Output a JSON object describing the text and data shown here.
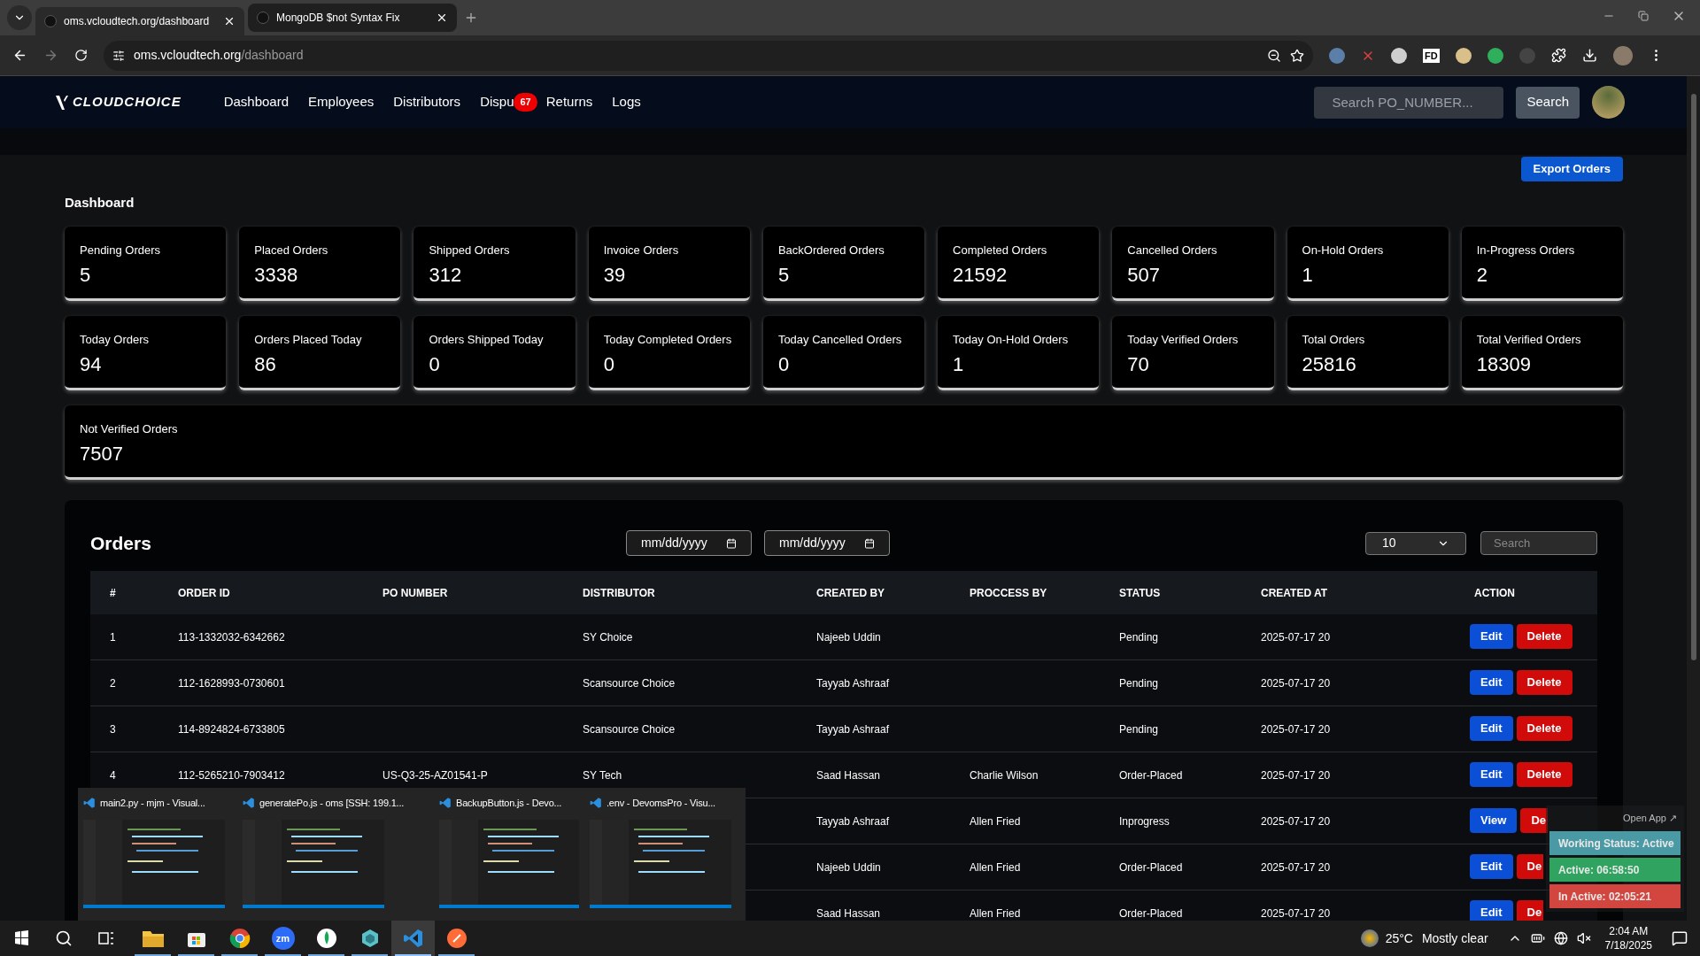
{
  "browser": {
    "tabs": [
      {
        "title": "oms.vcloudtech.org/dashboard",
        "selected": true
      },
      {
        "title": "MongoDB $not Syntax Fix",
        "selected": false
      }
    ],
    "address": {
      "host": "oms.vcloudtech.org",
      "path": "/dashboard"
    },
    "extension_label": "FD"
  },
  "nav": {
    "logo": "CLOUDCHOICE",
    "links": [
      {
        "label": "Dashboard"
      },
      {
        "label": "Employees"
      },
      {
        "label": "Distributors"
      },
      {
        "label": "Dispu",
        "badge": "67"
      },
      {
        "label": "Returns"
      },
      {
        "label": "Logs"
      }
    ],
    "search": {
      "placeholder": "Search PO_NUMBER..."
    },
    "search_button": "Search"
  },
  "export_button": "Export Orders",
  "dashboard": {
    "title": "Dashboard",
    "card_rows": [
      [
        {
          "label": "Pending Orders",
          "value": "5"
        },
        {
          "label": "Placed Orders",
          "value": "3338"
        },
        {
          "label": "Shipped Orders",
          "value": "312"
        },
        {
          "label": "Invoice Orders",
          "value": "39"
        },
        {
          "label": "BackOrdered Orders",
          "value": "5"
        },
        {
          "label": "Completed Orders",
          "value": "21592"
        },
        {
          "label": "Cancelled Orders",
          "value": "507"
        },
        {
          "label": "On-Hold Orders",
          "value": "1"
        },
        {
          "label": "In-Progress Orders",
          "value": "2"
        }
      ],
      [
        {
          "label": "Today Orders",
          "value": "94"
        },
        {
          "label": "Orders Placed Today",
          "value": "86"
        },
        {
          "label": "Orders Shipped Today",
          "value": "0"
        },
        {
          "label": "Today Completed Orders",
          "value": "0"
        },
        {
          "label": "Today Cancelled Orders",
          "value": "0"
        },
        {
          "label": "Today On-Hold Orders",
          "value": "1"
        },
        {
          "label": "Today Verified Orders",
          "value": "70"
        },
        {
          "label": "Total Orders",
          "value": "25816"
        },
        {
          "label": "Total Verified Orders",
          "value": "18309"
        }
      ],
      [
        {
          "label": "Not Verified Orders",
          "value": "7507"
        }
      ]
    ]
  },
  "orders": {
    "title": "Orders",
    "date_from": {
      "placeholder": "mm/dd/yyyy"
    },
    "date_to": {
      "placeholder": "mm/dd/yyyy"
    },
    "page_size": "10",
    "search": {
      "placeholder": "Search"
    },
    "columns": [
      "#",
      "ORDER ID",
      "PO NUMBER",
      "DISTRIBUTOR",
      "CREATED BY",
      "PROCCESS BY",
      "STATUS",
      "CREATED AT",
      "ACTION"
    ],
    "rows": [
      {
        "cells": [
          "1",
          "113-1332032-6342662",
          "",
          "SY Choice",
          "Najeeb Uddin",
          "",
          "Pending",
          "2025-07-17 20"
        ],
        "actions": [
          {
            "label": "Edit",
            "kind": "primary"
          },
          {
            "label": "Delete",
            "kind": "danger"
          }
        ]
      },
      {
        "cells": [
          "2",
          "112-1628993-0730601",
          "",
          "Scansource Choice",
          "Tayyab Ashraaf",
          "",
          "Pending",
          "2025-07-17 20"
        ],
        "actions": [
          {
            "label": "Edit",
            "kind": "primary"
          },
          {
            "label": "Delete",
            "kind": "danger"
          }
        ]
      },
      {
        "cells": [
          "3",
          "114-8924824-6733805",
          "",
          "Scansource Choice",
          "Tayyab Ashraaf",
          "",
          "Pending",
          "2025-07-17 20"
        ],
        "actions": [
          {
            "label": "Edit",
            "kind": "primary"
          },
          {
            "label": "Delete",
            "kind": "danger"
          }
        ]
      },
      {
        "cells": [
          "4",
          "112-5265210-7903412",
          "US-Q3-25-AZ01541-P",
          "SY Tech",
          "Saad Hassan",
          "Charlie Wilson",
          "Order-Placed",
          "2025-07-17 20"
        ],
        "actions": [
          {
            "label": "Edit",
            "kind": "primary"
          },
          {
            "label": "Delete",
            "kind": "danger"
          }
        ]
      },
      {
        "cells": [
          "",
          "",
          "",
          "",
          "Tayyab Ashraaf",
          "Allen Fried",
          "Inprogress",
          "2025-07-17 20"
        ],
        "actions": [
          {
            "label": "View",
            "kind": "primary"
          },
          {
            "label": "De",
            "kind": "danger",
            "covered": true
          }
        ]
      },
      {
        "cells": [
          "",
          "",
          "",
          "",
          "Najeeb Uddin",
          "Allen Fried",
          "Order-Placed",
          "2025-07-17 20"
        ],
        "actions": [
          {
            "label": "Edit",
            "kind": "primary"
          },
          {
            "label": "De",
            "kind": "danger",
            "covered": true
          }
        ]
      },
      {
        "cells": [
          "",
          "",
          "",
          "",
          "Saad Hassan",
          "Allen Fried",
          "Order-Placed",
          "2025-07-17 20"
        ],
        "actions": [
          {
            "label": "Edit",
            "kind": "primary"
          },
          {
            "label": "De",
            "kind": "danger",
            "covered": true
          }
        ]
      }
    ]
  },
  "window_previews": [
    {
      "title": "main2.py - mjm - Visual..."
    },
    {
      "title": "generatePo.js - oms [SSH: 199.1..."
    },
    {
      "title": "BackupButton.js - Devo..."
    },
    {
      "title": ".env - DevomsPro - Visu..."
    }
  ],
  "status_widget": {
    "open_app": "Open App ↗",
    "lines": [
      {
        "text": "Working Status: Active",
        "color": "#4a9aa5"
      },
      {
        "text": "Active: 06:58:50",
        "color": "#2fa35f"
      },
      {
        "text": "In Active: 02:05:21",
        "color": "#d2463f"
      }
    ]
  },
  "taskbar": {
    "apps": [
      {
        "kind": "explorer",
        "selected": false
      },
      {
        "kind": "store",
        "selected": false
      },
      {
        "kind": "chrome",
        "selected": false
      },
      {
        "kind": "zoom",
        "label": "zm",
        "selected": false
      },
      {
        "kind": "mongodb",
        "selected": false
      },
      {
        "kind": "cube",
        "selected": false
      },
      {
        "kind": "vscode",
        "selected": true
      },
      {
        "kind": "postman",
        "selected": false
      }
    ],
    "temperature": "25°C",
    "weather": "Mostly clear",
    "time": "2:04 AM",
    "date": "7/18/2025"
  }
}
